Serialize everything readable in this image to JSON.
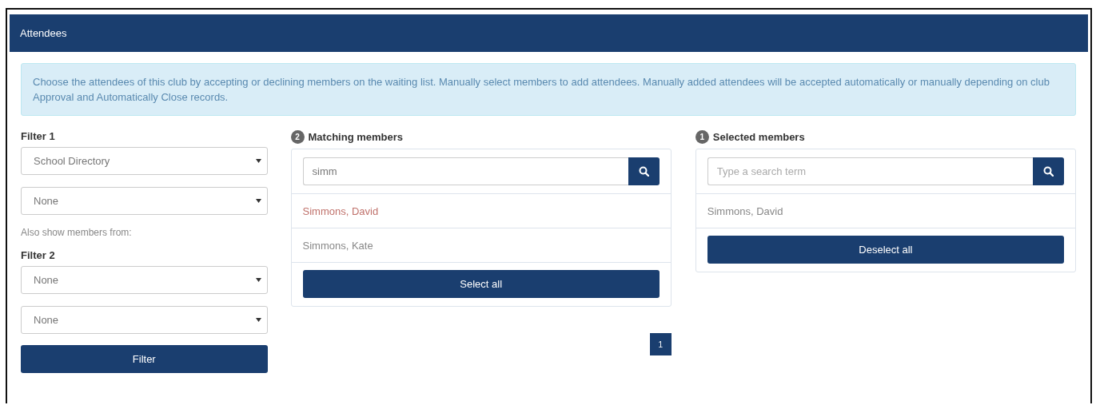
{
  "panel": {
    "title": "Attendees"
  },
  "notice": "Choose the attendees of this club by accepting or declining members on the waiting list. Manually select members to add attendees. Manually added attendees will be accepted automatically or manually depending on club Approval and Automatically Close records.",
  "filter_1": {
    "label": "Filter 1",
    "selects": [
      "School Directory",
      "None"
    ]
  },
  "also_show": "Also show members from:",
  "filter_2": {
    "label": "Filter 2",
    "selects": [
      "None",
      "None"
    ]
  },
  "filter_button": "Filter",
  "matching": {
    "count": "2",
    "title": "Matching members",
    "search": {
      "value": "simm"
    },
    "items": [
      {
        "name": "Simmons, David",
        "selected": true
      },
      {
        "name": "Simmons, Kate",
        "selected": false
      }
    ],
    "button": "Select all",
    "pages": [
      {
        "label": "1",
        "selected": true
      }
    ]
  },
  "selected": {
    "count": "1",
    "title": "Selected members",
    "search": {
      "placeholder": "Type a search term"
    },
    "items": [
      {
        "name": "Simmons, David"
      }
    ],
    "button": "Deselect all"
  }
}
